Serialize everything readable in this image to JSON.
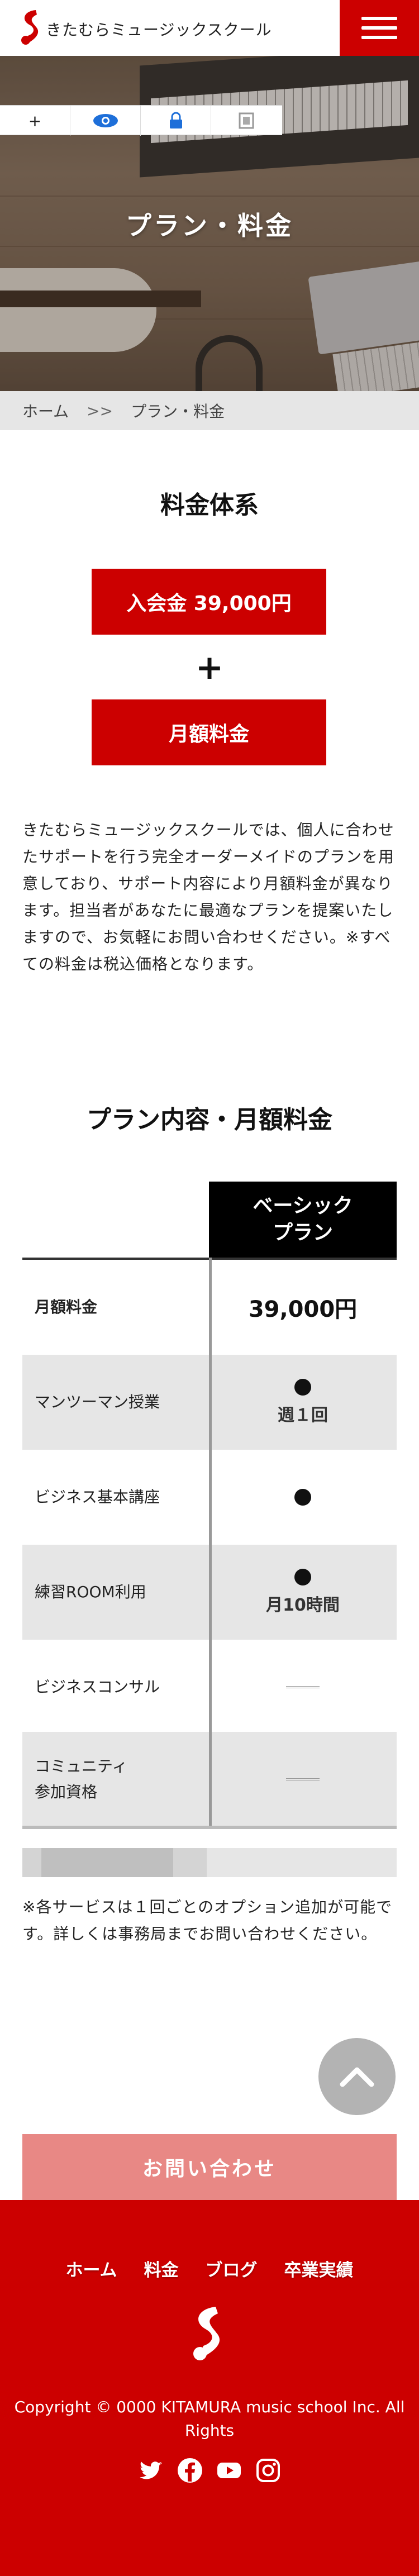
{
  "header": {
    "logo_text": "きたむらミュージックスクール"
  },
  "hero": {
    "title": "プラン・料金"
  },
  "toolbar": {
    "add_label": "+"
  },
  "breadcrumb": {
    "home": "ホーム",
    "separator": ">>",
    "current": "プラン・料金"
  },
  "pricing": {
    "title": "料金体系",
    "entry_fee": "入会金 39,000円",
    "plus": "+",
    "monthly_fee": "月額料金",
    "description": "きたむらミュージックスクールでは、個人に合わせたサポートを行う完全オーダーメイドのプランを用意しており、サポート内容により月額料金が異なります。担当者があなたに最適なプランを提案いたしますので、お気軽にお問い合わせください。※すべての料金は税込価格となります。"
  },
  "plans": {
    "title": "プラン内容・月額料金",
    "column_header": "ベーシック\nプラン",
    "rows": [
      {
        "label": "月額料金",
        "value": "39,000円"
      },
      {
        "label": "マンツーマン授業",
        "value": "週１回"
      },
      {
        "label": "ビジネス基本講座",
        "value": ""
      },
      {
        "label": "練習ROOM利用",
        "value": "月10時間"
      },
      {
        "label": "ビジネスコンサル",
        "value": ""
      },
      {
        "label": "コミュニティ\n参加資格",
        "value": ""
      }
    ],
    "note": "※各サービスは１回ごとのオプション追加が可能です。詳しくは事務局までお問い合わせください。"
  },
  "contact": {
    "label": "お問い合わせ"
  },
  "footer": {
    "nav": [
      "ホーム",
      "料金",
      "ブログ",
      "卒業実績"
    ],
    "copyright": "Copyright © 0000 KITAMURA music school Inc. All Rights",
    "social": [
      "twitter-icon",
      "facebook-icon",
      "youtube-icon",
      "instagram-icon"
    ]
  },
  "colors": {
    "brand_red": "#cc0000",
    "contact_pink": "#e88885",
    "table_header": "#000000",
    "row_gray": "#e6e6e6"
  }
}
